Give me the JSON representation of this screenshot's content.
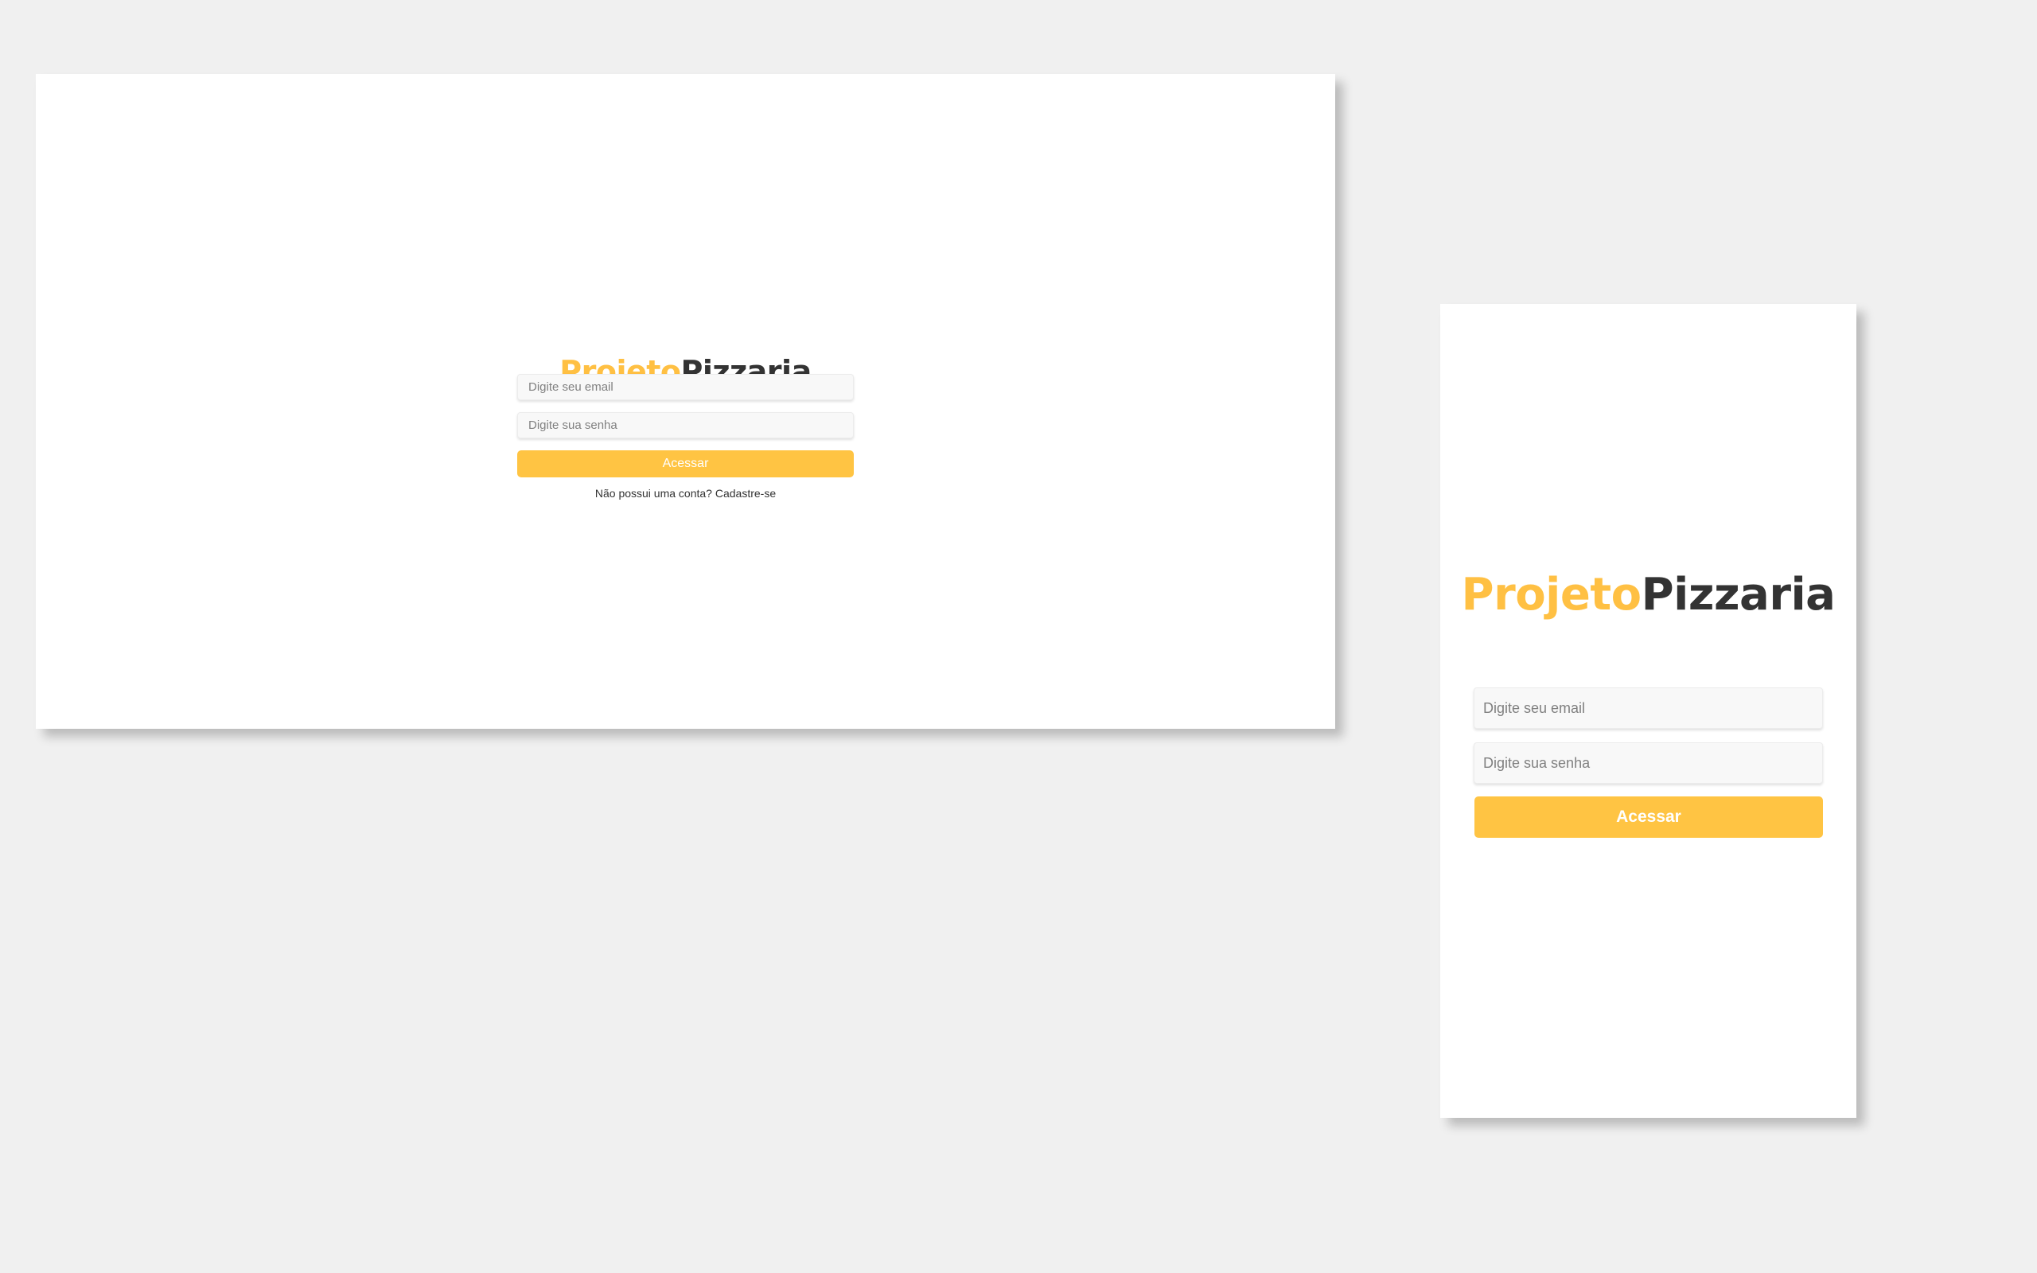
{
  "brand": {
    "part1": "Projeto",
    "part2": "Pizzaria",
    "accent_color": "#ffc043",
    "dark_color": "#333333"
  },
  "login": {
    "email_placeholder": "Digite seu email",
    "password_placeholder": "Digite sua senha",
    "submit_label": "Acessar",
    "signup_prompt": "Não possui uma conta? Cadastre-se"
  }
}
